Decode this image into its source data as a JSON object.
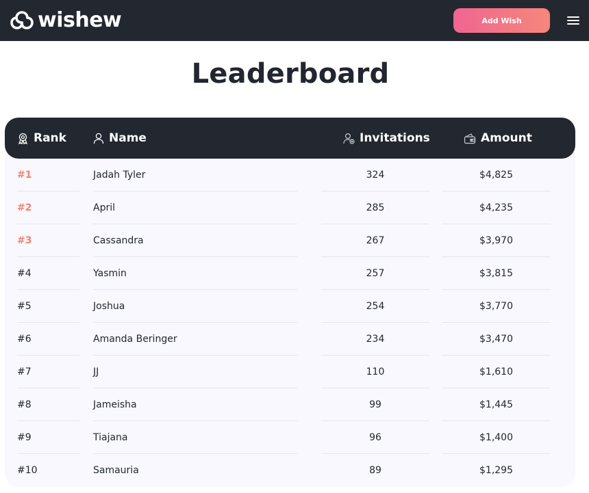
{
  "brand": {
    "name": "wishew"
  },
  "nav": {
    "add_wish_label": "Add Wish"
  },
  "page": {
    "title": "Leaderboard"
  },
  "table": {
    "columns": {
      "rank": "Rank",
      "name": "Name",
      "invitations": "Invitations",
      "amount": "Amount"
    },
    "rows": [
      {
        "rank": "#1",
        "name": "Jadah Tyler",
        "invitations": "324",
        "amount": "$4,825"
      },
      {
        "rank": "#2",
        "name": "April",
        "invitations": "285",
        "amount": "$4,235"
      },
      {
        "rank": "#3",
        "name": "Cassandra",
        "invitations": "267",
        "amount": "$3,970"
      },
      {
        "rank": "#4",
        "name": "Yasmin",
        "invitations": "257",
        "amount": "$3,815"
      },
      {
        "rank": "#5",
        "name": "Joshua",
        "invitations": "254",
        "amount": "$3,770"
      },
      {
        "rank": "#6",
        "name": "Amanda Beringer",
        "invitations": "234",
        "amount": "$3,470"
      },
      {
        "rank": "#7",
        "name": "JJ",
        "invitations": "110",
        "amount": "$1,610"
      },
      {
        "rank": "#8",
        "name": "Jameisha",
        "invitations": "99",
        "amount": "$1,445"
      },
      {
        "rank": "#9",
        "name": "Tiajana",
        "invitations": "96",
        "amount": "$1,400"
      },
      {
        "rank": "#10",
        "name": "Samauria",
        "invitations": "89",
        "amount": "$1,295"
      }
    ]
  },
  "colors": {
    "navbar": "#23272f",
    "accent_gradient_start": "#ef6592",
    "accent_gradient_end": "#f6877a",
    "top_rank": "#f3836f",
    "table_background": "#f8f8fe"
  },
  "icons": {
    "logo": "wishew-logo-icon",
    "menu": "hamburger-menu-icon",
    "rank": "medal-icon",
    "name": "user-icon",
    "invitations": "user-add-icon",
    "amount": "wallet-icon"
  }
}
